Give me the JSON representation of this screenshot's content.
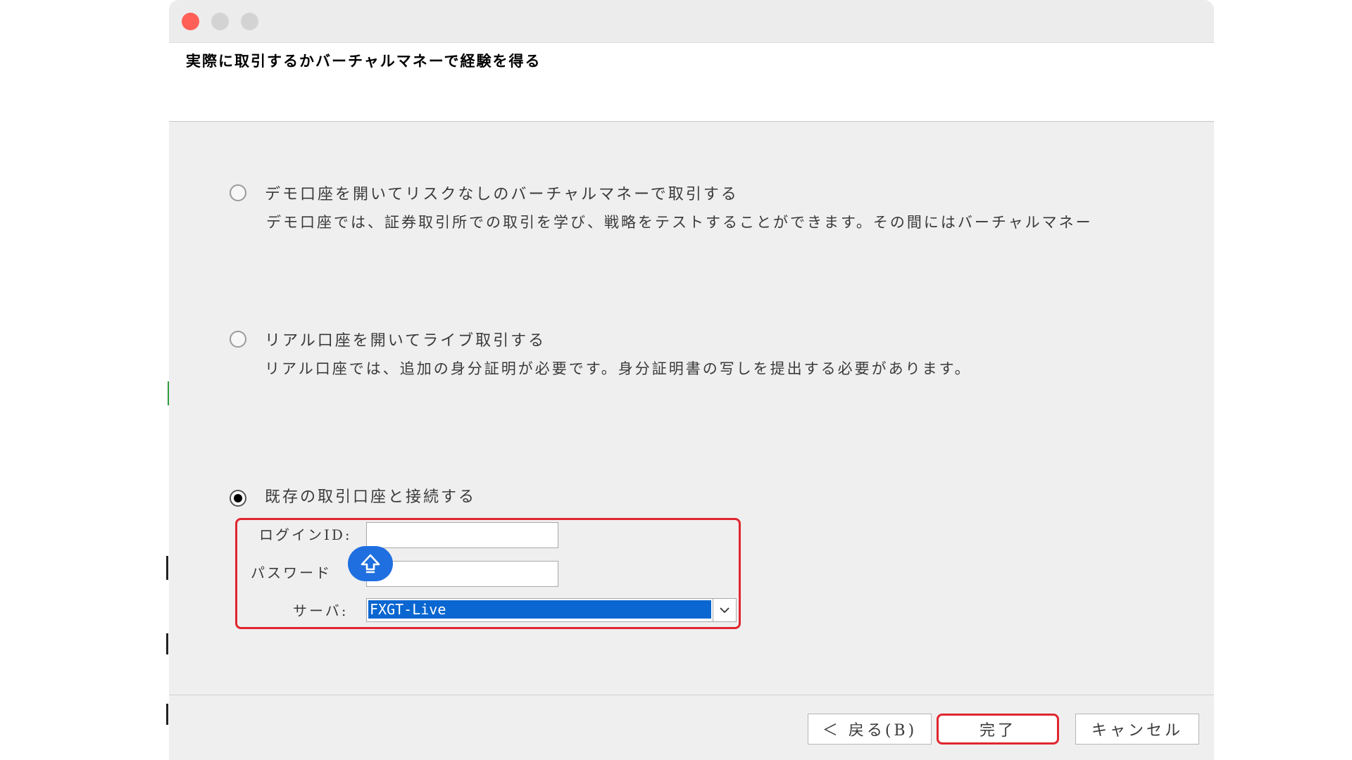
{
  "window": {
    "header_title": "実際に取引するかバーチャルマネーで経験を得る",
    "controls": {
      "close_color": "#ff5f57",
      "minimize_color": "#d3d3d3",
      "maximize_color": "#d3d3d3"
    }
  },
  "options": [
    {
      "title": "デモ口座を開いてリスクなしのバーチャルマネーで取引する",
      "description": "デモ口座では、証券取引所での取引を学び、戦略をテストすることができます。その間にはバーチャルマネー",
      "selected": false
    },
    {
      "title": "リアル口座を開いてライブ取引する",
      "description": "リアル口座では、追加の身分証明が必要です。身分証明書の写しを提出する必要があります。",
      "selected": false
    },
    {
      "title": "既存の取引口座と接続する",
      "selected": true
    }
  ],
  "login_form": {
    "login_id_label": "ログインID:",
    "login_id_value": "",
    "password_label": "パスワード",
    "password_value": "",
    "server_label": "サーバ:",
    "server_value": "FXGT-Live"
  },
  "buttons": {
    "back": "＜ 戻る(B)",
    "finish": "完了",
    "cancel": "キャンセル"
  },
  "colors": {
    "highlight_red": "#e0262f",
    "selection_blue": "#0a66d0",
    "badge_blue": "#1f6fe0"
  },
  "icons": {
    "shift_badge": "keyboard-shift-icon",
    "dropdown": "chevron-down-icon"
  }
}
